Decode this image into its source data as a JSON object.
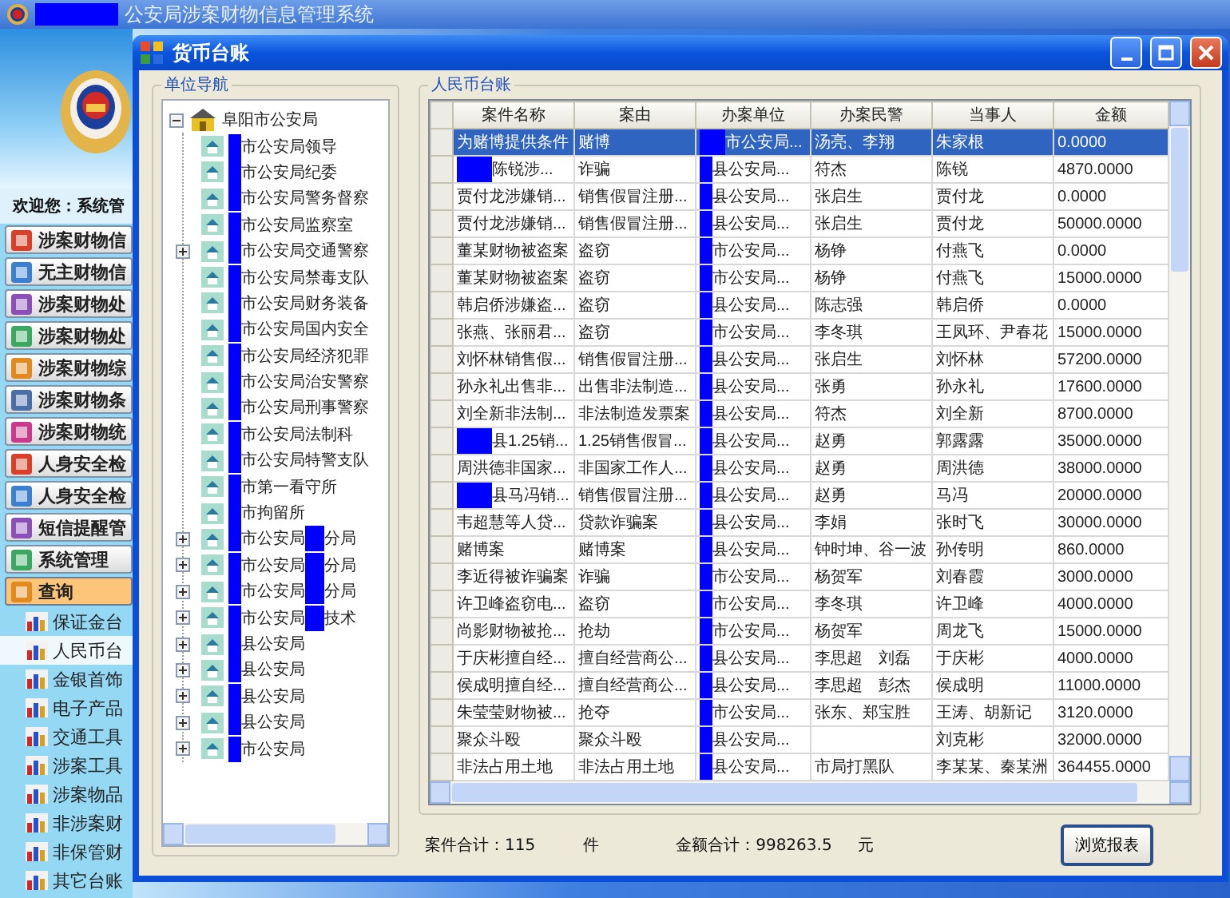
{
  "app": {
    "title": "公安局涉案财物信息管理系统"
  },
  "sidebar": {
    "welcome": "欢迎您：系统管",
    "menu": [
      {
        "label": "涉案财物信",
        "expanded": false
      },
      {
        "label": "无主财物信",
        "expanded": false
      },
      {
        "label": "涉案财物处",
        "expanded": false
      },
      {
        "label": "涉案财物处",
        "expanded": false
      },
      {
        "label": "涉案财物综",
        "expanded": false
      },
      {
        "label": "涉案财物条",
        "expanded": false
      },
      {
        "label": "涉案财物统",
        "expanded": false
      },
      {
        "label": "人身安全检",
        "expanded": false
      },
      {
        "label": "人身安全检",
        "expanded": false
      },
      {
        "label": "短信提醒管",
        "expanded": false
      },
      {
        "label": "系统管理",
        "expanded": false
      },
      {
        "label": "查询",
        "expanded": true,
        "children": [
          {
            "label": "保证金台",
            "selected": false
          },
          {
            "label": "人民币台",
            "selected": true
          },
          {
            "label": "金银首饰",
            "selected": false
          },
          {
            "label": "电子产品",
            "selected": false
          },
          {
            "label": "交通工具",
            "selected": false
          },
          {
            "label": "涉案工具",
            "selected": false
          },
          {
            "label": "涉案物品",
            "selected": false
          },
          {
            "label": "非涉案财",
            "selected": false
          },
          {
            "label": "非保管财",
            "selected": false
          },
          {
            "label": "其它台账",
            "selected": false
          }
        ]
      }
    ]
  },
  "dialog": {
    "title": "货币台账",
    "tree": {
      "title": "单位导航",
      "root": {
        "label": "阜阳市公安局",
        "expanded": true,
        "children": [
          {
            "label": "市公安局领导"
          },
          {
            "label": "市公安局纪委"
          },
          {
            "label": "市公安局警务督察"
          },
          {
            "label": "市公安局监察室"
          },
          {
            "label": "市公安局交通警察",
            "expanded": false
          },
          {
            "label": "市公安局禁毒支队"
          },
          {
            "label": "市公安局财务装备"
          },
          {
            "label": "市公安局国内安全"
          },
          {
            "label": "市公安局经济犯罪"
          },
          {
            "label": "市公安局治安警察"
          },
          {
            "label": "市公安局刑事警察"
          },
          {
            "label": "市公安局法制科"
          },
          {
            "label": "市公安局特警支队"
          },
          {
            "label": "市第一看守所"
          },
          {
            "label": "市拘留所"
          },
          {
            "label": "市公安局",
            "suffix": "分局",
            "expanded": false
          },
          {
            "label": "市公安局",
            "suffix": "分局",
            "expanded": false
          },
          {
            "label": "市公安局",
            "suffix": "分局",
            "expanded": false
          },
          {
            "label": "市公安局",
            "suffix": "技术",
            "expanded": false
          },
          {
            "label": "县公安局",
            "expanded": false
          },
          {
            "label": "县公安局",
            "expanded": false
          },
          {
            "label": "县公安局",
            "expanded": false
          },
          {
            "label": "县公安局",
            "expanded": false
          },
          {
            "label": "市公安局",
            "expanded": false
          }
        ]
      }
    },
    "ledger": {
      "title": "人民币台账",
      "columns": [
        "案件名称",
        "案由",
        "办案单位",
        "办案民警",
        "当事人",
        "金额"
      ],
      "rows": [
        {
          "selected": true,
          "name_redacted": false,
          "cells": [
            "为赌博提供条件",
            "赌博",
            "市公安局...",
            "汤亮、李翔",
            "朱家根",
            "0.0000"
          ]
        },
        {
          "selected": false,
          "name_redacted": true,
          "cells": [
            "陈锐涉...",
            "诈骗",
            "县公安局...",
            "符杰",
            "陈锐",
            "4870.0000"
          ]
        },
        {
          "selected": false,
          "name_redacted": false,
          "cells": [
            "贾付龙涉嫌销...",
            "销售假冒注册...",
            "县公安局...",
            "张启生",
            "贾付龙",
            "0.0000"
          ]
        },
        {
          "selected": false,
          "name_redacted": false,
          "cells": [
            "贾付龙涉嫌销...",
            "销售假冒注册...",
            "县公安局...",
            "张启生",
            "贾付龙",
            "50000.0000"
          ]
        },
        {
          "selected": false,
          "name_redacted": false,
          "cells": [
            "董某财物被盗案",
            "盗窃",
            "市公安局...",
            "杨铮",
            "付燕飞",
            "0.0000"
          ]
        },
        {
          "selected": false,
          "name_redacted": false,
          "cells": [
            "董某财物被盗案",
            "盗窃",
            "市公安局...",
            "杨铮",
            "付燕飞",
            "15000.0000"
          ]
        },
        {
          "selected": false,
          "name_redacted": false,
          "cells": [
            "韩启侨涉嫌盗...",
            "盗窃",
            "县公安局...",
            "陈志强",
            "韩启侨",
            "0.0000"
          ]
        },
        {
          "selected": false,
          "name_redacted": false,
          "cells": [
            "张燕、张丽君...",
            "盗窃",
            "市公安局...",
            "李冬琪",
            "王凤环、尹春花",
            "15000.0000"
          ]
        },
        {
          "selected": false,
          "name_redacted": false,
          "cells": [
            "刘怀林销售假...",
            "销售假冒注册...",
            "县公安局...",
            "张启生",
            "刘怀林",
            "57200.0000"
          ]
        },
        {
          "selected": false,
          "name_redacted": false,
          "cells": [
            "孙永礼出售非...",
            "出售非法制造...",
            "县公安局...",
            "张勇",
            "孙永礼",
            "17600.0000"
          ]
        },
        {
          "selected": false,
          "name_redacted": false,
          "cells": [
            "刘全新非法制...",
            "非法制造发票案",
            "县公安局...",
            "符杰",
            "刘全新",
            "8700.0000"
          ]
        },
        {
          "selected": false,
          "name_redacted": true,
          "cells": [
            "县1.25销...",
            "1.25销售假冒...",
            "县公安局...",
            "赵勇",
            "郭露露",
            "35000.0000"
          ]
        },
        {
          "selected": false,
          "name_redacted": false,
          "cells": [
            "周洪德非国家...",
            "非国家工作人...",
            "县公安局...",
            "赵勇",
            "周洪德",
            "38000.0000"
          ]
        },
        {
          "selected": false,
          "name_redacted": true,
          "cells": [
            "县马冯销...",
            "销售假冒注册...",
            "县公安局...",
            "赵勇",
            "马冯",
            "20000.0000"
          ]
        },
        {
          "selected": false,
          "name_redacted": false,
          "cells": [
            "韦超慧等人贷...",
            "贷款诈骗案",
            "县公安局...",
            "李娟",
            "张时飞",
            "30000.0000"
          ]
        },
        {
          "selected": false,
          "name_redacted": false,
          "cells": [
            "赌博案",
            "赌博案",
            "县公安局...",
            "钟时坤、谷一波",
            "孙传明",
            "860.0000"
          ]
        },
        {
          "selected": false,
          "name_redacted": false,
          "cells": [
            "李近得被诈骗案",
            "诈骗",
            "市公安局...",
            "杨贺军",
            "刘春霞",
            "3000.0000"
          ]
        },
        {
          "selected": false,
          "name_redacted": false,
          "cells": [
            "许卫峰盗窃电...",
            "盗窃",
            "市公安局...",
            "李冬琪",
            "许卫峰",
            "4000.0000"
          ]
        },
        {
          "selected": false,
          "name_redacted": false,
          "cells": [
            "尚影财物被抢...",
            "抢劫",
            "市公安局...",
            "杨贺军",
            "周龙飞",
            "15000.0000"
          ]
        },
        {
          "selected": false,
          "name_redacted": false,
          "cells": [
            "于庆彬擅自经...",
            "擅自经营商公...",
            "县公安局...",
            "李思超　刘磊",
            "于庆彬",
            "4000.0000"
          ]
        },
        {
          "selected": false,
          "name_redacted": false,
          "cells": [
            "侯成明擅自经...",
            "擅自经营商公...",
            "县公安局...",
            "李思超　彭杰",
            "侯成明",
            "11000.0000"
          ]
        },
        {
          "selected": false,
          "name_redacted": false,
          "cells": [
            "朱莹莹财物被...",
            "抢夺",
            "市公安局...",
            "张东、郑宝胜",
            "王涛、胡新记",
            "3120.0000"
          ]
        },
        {
          "selected": false,
          "name_redacted": false,
          "cells": [
            "聚众斗殴",
            "聚众斗殴",
            "县公安局...",
            "",
            "刘克彬",
            "32000.0000"
          ]
        },
        {
          "selected": false,
          "name_redacted": false,
          "cells": [
            "非法占用土地",
            "非法占用土地",
            "县公安局...",
            "市局打黑队",
            "李某某、秦某洲",
            "364455.0000"
          ]
        }
      ]
    },
    "summary": [
      {
        "text": "案件合计：115",
        "unit": "件"
      },
      {
        "text": "金额合计：998263.5",
        "unit": "元"
      }
    ],
    "buttons": [
      "浏览报表"
    ]
  }
}
